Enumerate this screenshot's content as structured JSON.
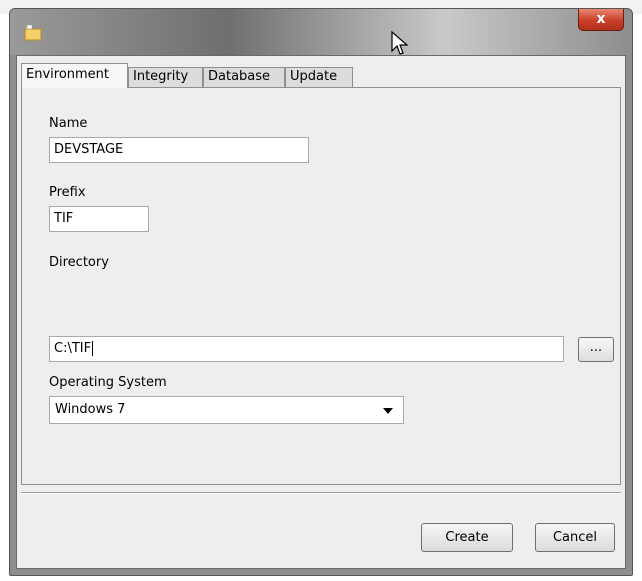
{
  "window": {
    "close_label": "x"
  },
  "tabs": [
    {
      "label": "Environment",
      "active": true
    },
    {
      "label": "Integrity",
      "active": false
    },
    {
      "label": "Database",
      "active": false
    },
    {
      "label": "Update",
      "active": false
    }
  ],
  "form": {
    "name_label": "Name",
    "name_value": "DEVSTAGE",
    "prefix_label": "Prefix",
    "prefix_value": "TIF",
    "directory_label": "Directory",
    "directory_value": "C:\\TIF",
    "browse_label": "...",
    "os_label": "Operating System",
    "os_value": "Windows 7"
  },
  "buttons": {
    "create": "Create",
    "cancel": "Cancel"
  },
  "icons": {
    "app": "folder-icon",
    "close": "close-icon",
    "dropdown": "chevron-down-icon",
    "cursor": "mouse-cursor-icon"
  },
  "colors": {
    "close_button": "#c9402a",
    "dialog_background": "#eeeeee"
  }
}
